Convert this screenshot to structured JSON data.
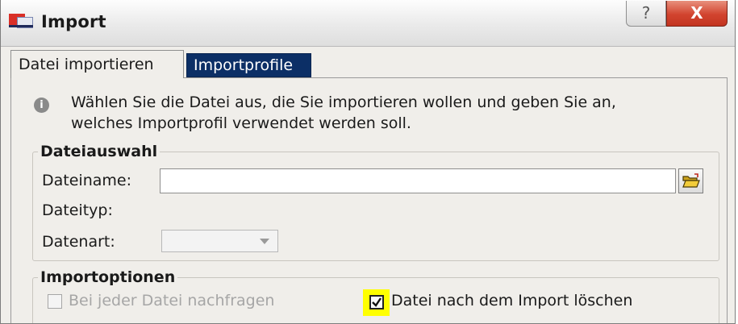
{
  "window": {
    "title": "Import",
    "help_glyph": "?",
    "close_glyph": "X"
  },
  "tabs": [
    {
      "label": "Datei importieren",
      "active": true
    },
    {
      "label": "Importprofile",
      "active": false
    }
  ],
  "info": {
    "icon": "info-icon",
    "glyph": "i",
    "line1": "Wählen Sie die Datei aus, die Sie importieren wollen und geben Sie an,",
    "line2": "welches Importprofil verwendet werden soll."
  },
  "dateiauswahl": {
    "legend": "Dateiauswahl",
    "dateiname_label": "Dateiname:",
    "dateiname_value": "",
    "dateityp_label": "Dateityp:",
    "datenart_label": "Datenart:",
    "datenart_value": ""
  },
  "importoptionen": {
    "legend": "Importoptionen",
    "option1_label": "Bei jeder Datei nachfragen",
    "option1_checked": false,
    "option1_enabled": false,
    "option2_label": "Datei nach dem Import löschen",
    "option2_checked": true
  },
  "colors": {
    "tab_active_bg": "#f0eeea",
    "tab_inactive_bg": "#0c2f66",
    "close_button": "#d2442f",
    "checkbox_highlight": "#ffff00"
  }
}
